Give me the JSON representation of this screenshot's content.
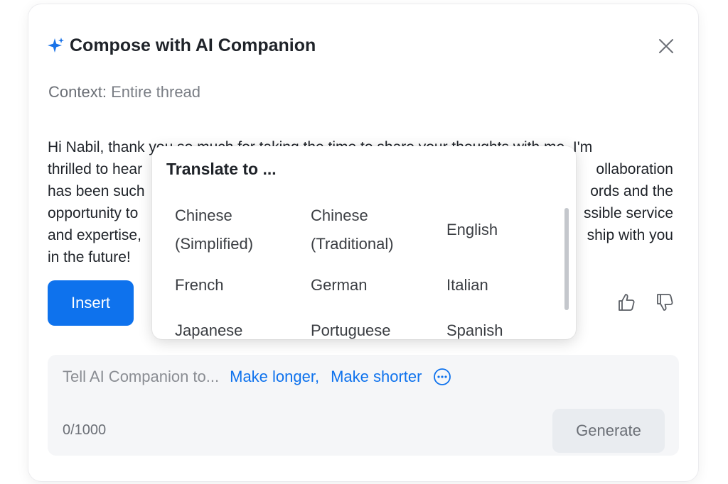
{
  "dialog": {
    "title": "Compose with AI Companion",
    "context_label": "Context:",
    "context_value": "Entire thread",
    "draft_lines": [
      "Hi Nabil, thank you so much for taking the time to share your thoughts with me. I'm",
      "thrilled to hear",
      "ollaboration",
      "has been such",
      "ords and the",
      "opportunity to",
      "ssible service",
      "and expertise,",
      "ship with you",
      "in the future!"
    ],
    "insert_label": "Insert"
  },
  "popover": {
    "title": "Translate to ...",
    "languages": [
      "Chinese (Simplified)",
      "Chinese (Traditional)",
      "English",
      "French",
      "German",
      "Italian",
      "Japanese",
      "Portuguese",
      "Spanish"
    ]
  },
  "prompt": {
    "placeholder": "Tell AI Companion to...",
    "suggestions": [
      "Make longer,",
      "Make shorter"
    ],
    "counter": "0/1000",
    "generate_label": "Generate"
  },
  "colors": {
    "accent": "#0e72ed",
    "sparkle": "#1a73e8",
    "muted": "#6b6f76"
  },
  "icons": [
    "sparkle-icon",
    "close-icon",
    "thumbs-up-icon",
    "thumbs-down-icon",
    "more-options-icon"
  ]
}
